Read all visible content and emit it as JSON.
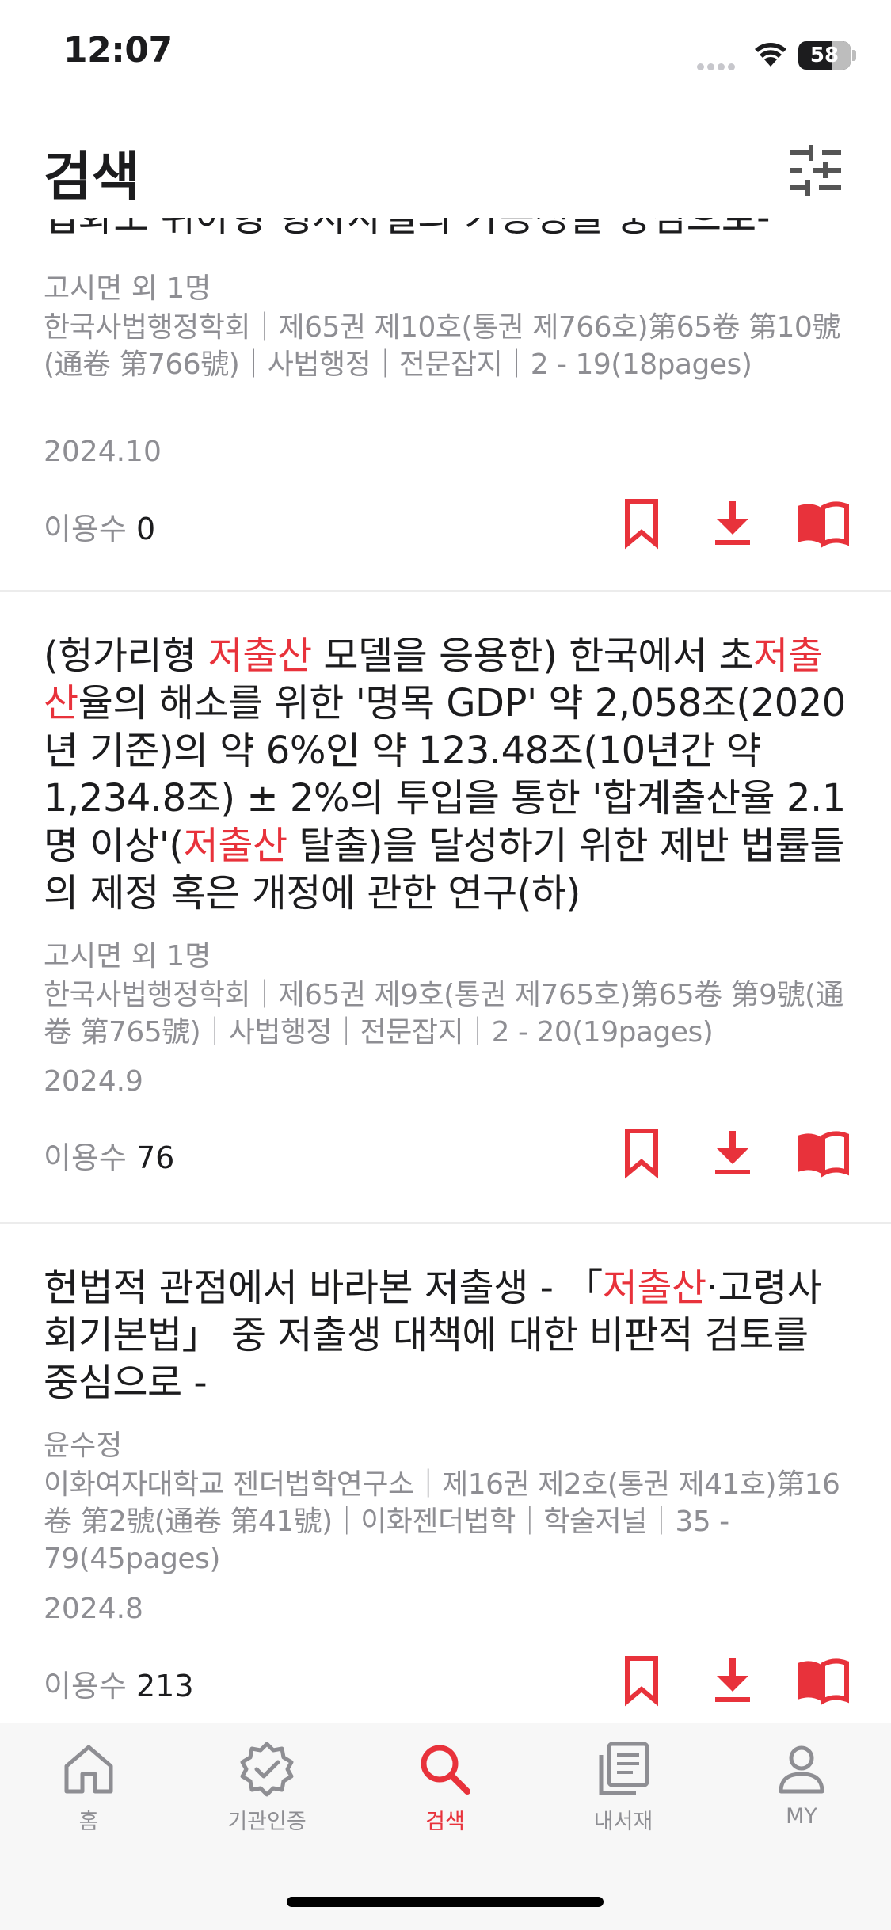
{
  "status": {
    "time": "12:07",
    "battery": "58"
  },
  "header": {
    "title": "검색"
  },
  "colors": {
    "accent": "#e8323b",
    "text_primary": "#1c1c1e",
    "text_secondary": "#8e8e93"
  },
  "results": {
    "prev_title_cut": "입화도 위아형 형사사벌의 가능성을 중심으로-",
    "items": [
      {
        "author": "고시면 외 1명",
        "meta": "한국사법행정학회｜제65권 제10호(통권 제766호)第65卷 第10號(通卷 第766號)｜사법행정｜전문잡지｜2 - 19(18pages)",
        "date": "2024.10",
        "usage_label": "이용수",
        "usage_value": "0"
      },
      {
        "title_parts": [
          "(헝가리형 ",
          "저출산",
          " 모델을 응용한) 한국에서 초",
          "저출산",
          "율의 해소를 위한 '명목 GDP' 약 2,058조(2020년 기준)의 약 6%인 약 123.48조(10년간 약 1,234.8조) ± 2%의 투입을 통한 '합계출산율 2.1명 이상'(",
          "저출산",
          " 탈출)을 달성하기 위한 제반 법률들의 제정 혹은 개정에 관한 연구(하)"
        ],
        "author": "고시면 외 1명",
        "meta": "한국사법행정학회｜제65권 제9호(통권 제765호)第65卷 第9號(通卷 第765號)｜사법행정｜전문잡지｜2 - 20(19pages)",
        "date": "2024.9",
        "usage_label": "이용수",
        "usage_value": "76"
      },
      {
        "title_parts": [
          "헌법적 관점에서 바라본 저출생 - 「",
          "저출산",
          "·고령사회기본법」 중 저출생 대책에 대한 비판적 검토를 중심으로 -"
        ],
        "author": "윤수정",
        "meta": "이화여자대학교 젠더법학연구소｜제16권 제2호(통권 제41호)第16卷 第2號(通卷 第41號)｜이화젠더법학｜학술저널｜35 - 79(45pages)",
        "date": "2024.8",
        "usage_label": "이용수",
        "usage_value": "213"
      }
    ]
  },
  "icons": {
    "filter": "sliders-icon",
    "bookmark": "bookmark-icon",
    "download": "download-icon",
    "read": "open-book-icon"
  },
  "tabbar": {
    "tabs": [
      {
        "label": "홈",
        "icon": "home-icon",
        "active": false
      },
      {
        "label": "기관인증",
        "icon": "verified-badge-icon",
        "active": false
      },
      {
        "label": "검색",
        "icon": "search-icon",
        "active": true
      },
      {
        "label": "내서재",
        "icon": "library-icon",
        "active": false
      },
      {
        "label": "MY",
        "icon": "person-icon",
        "active": false
      }
    ]
  }
}
